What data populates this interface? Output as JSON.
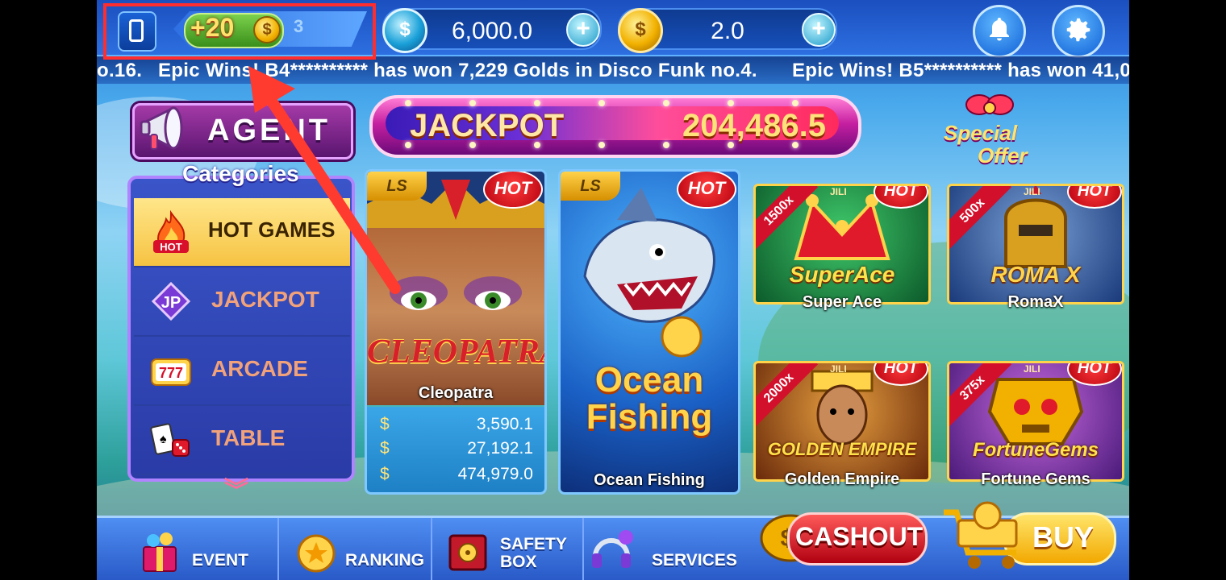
{
  "topbar": {
    "bonus_text": "+20",
    "bonus_partial_digit": "3",
    "balance_1": "6,000.0",
    "balance_2": "2.0",
    "coin_symbol": "$",
    "plus_symbol": "+",
    "icons": {
      "device": "phone-icon",
      "notifications": "bell-icon",
      "settings": "gear-icon"
    }
  },
  "ticker": {
    "messages": [
      "o.16.",
      "Epic Wins! B4********** has won 7,229 Golds in Disco Funk no.4.",
      "Epic Wins! B5********** has won 41,0"
    ]
  },
  "agent": {
    "label": "AGENT"
  },
  "jackpot": {
    "label": "JACKPOT",
    "value": "204,486.5"
  },
  "special_offer": {
    "line1": "Special",
    "line2": "Offer"
  },
  "categories": {
    "title": "Categories",
    "items": [
      {
        "label": "HOT GAMES",
        "icon": "flame-hot-icon",
        "icon_text": "HOT",
        "active": true
      },
      {
        "label": "JACKPOT",
        "icon": "jp-diamond-icon",
        "icon_text": "JP"
      },
      {
        "label": "ARCADE",
        "icon": "slot-777-icon",
        "icon_text": "777"
      },
      {
        "label": "TABLE",
        "icon": "cards-dice-icon",
        "icon_text": ""
      }
    ],
    "more_icon": "chevron-double-down-icon"
  },
  "games": {
    "badge_hot": "HOT",
    "badge_ls": "LS",
    "cleopatra": {
      "name": "Cleopatra",
      "logo": "CLEOPATRA",
      "prizes": [
        {
          "symbol": "$",
          "amount": "3,590.1"
        },
        {
          "symbol": "$",
          "amount": "27,192.1"
        },
        {
          "symbol": "$",
          "amount": "474,979.0"
        }
      ]
    },
    "ocean_fishing": {
      "name": "Ocean Fishing",
      "logo_line1": "Ocean",
      "logo_line2": "Fishing"
    },
    "small": [
      {
        "name": "Super Ace",
        "title": "SuperAce",
        "multiplier": "1500x",
        "provider": "JILI"
      },
      {
        "name": "RomaX",
        "title": "ROMA X",
        "multiplier": "500x",
        "provider": "JILI"
      },
      {
        "name": "Golden Empire",
        "title": "GOLDEN EMPIRE",
        "multiplier": "2000x",
        "provider": "JILI"
      },
      {
        "name": "Fortune Gems",
        "title": "FortuneGems",
        "multiplier": "375x",
        "provider": "JILI"
      }
    ]
  },
  "bottombar": {
    "event": "EVENT",
    "ranking": "RANKING",
    "safety_box_1": "SAFETY",
    "safety_box_2": "BOX",
    "services": "SERVICES",
    "cashout": "CASHOUT",
    "buy": "BUY"
  },
  "colors": {
    "highlight": "#ff2d2d",
    "arrow": "#ff3a2e"
  }
}
